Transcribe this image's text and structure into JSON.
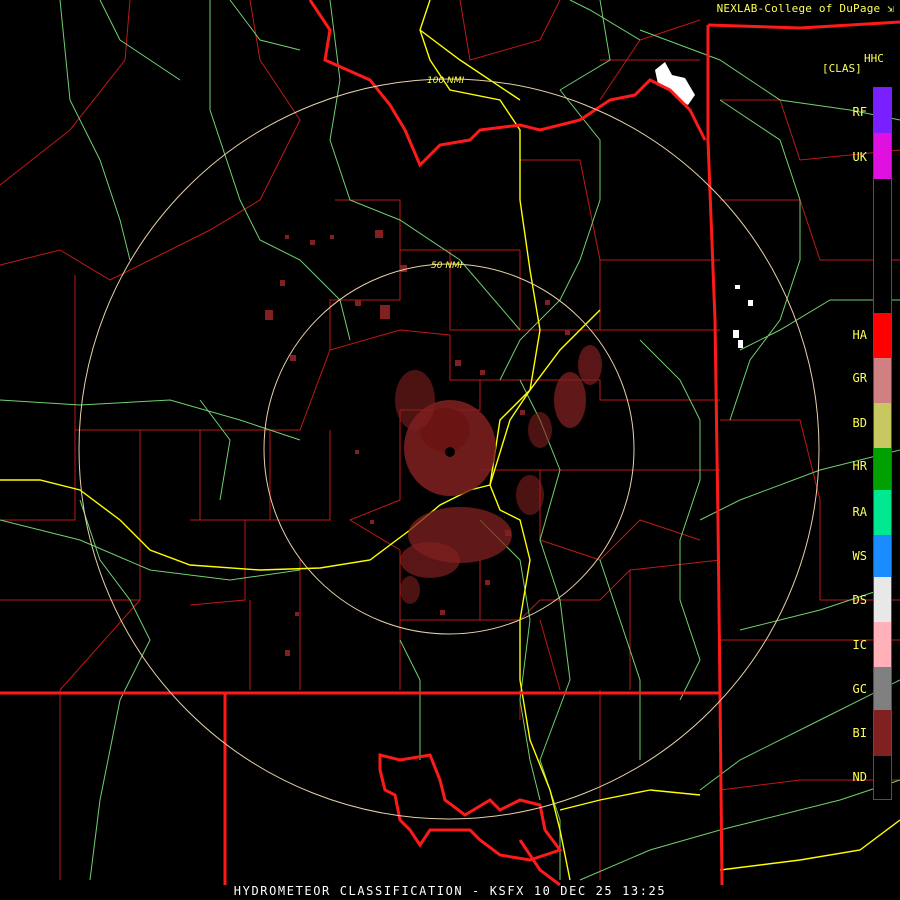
{
  "header": {
    "credit": "NEXLAB-College of DuPage"
  },
  "legend": {
    "product_code": "HHC",
    "mode": "[CLAS]",
    "classes": [
      {
        "code": "RF",
        "color": "#7a1fff"
      },
      {
        "code": "UK",
        "color": "#e010e0"
      },
      {
        "code": "HA",
        "color": "#ff0000"
      },
      {
        "code": "GR",
        "color": "#d08080"
      },
      {
        "code": "BD",
        "color": "#c8c860"
      },
      {
        "code": "HR",
        "color": "#00a000"
      },
      {
        "code": "RA",
        "color": "#00e890"
      },
      {
        "code": "WS",
        "color": "#1a8cff"
      },
      {
        "code": "DS",
        "color": "#e8e8e8"
      },
      {
        "code": "IC",
        "color": "#ffb0b8"
      },
      {
        "code": "GC",
        "color": "#808080"
      },
      {
        "code": "BI",
        "color": "#802020"
      },
      {
        "code": "ND",
        "color": "#000000"
      }
    ]
  },
  "range_rings": {
    "outer_label": "100 NMI",
    "inner_label": "50 NMI"
  },
  "footer": {
    "title": "HYDROMETEOR CLASSIFICATION - KSFX 10 DEC 25 13:25"
  },
  "colors": {
    "state_border": "#ff1a1a",
    "county_border": "#c01818",
    "river": "#70d070",
    "highway": "#ffff00",
    "range_ring": "#e8d0a8",
    "echo_bi": "#802020",
    "urban": "#ffffff"
  }
}
